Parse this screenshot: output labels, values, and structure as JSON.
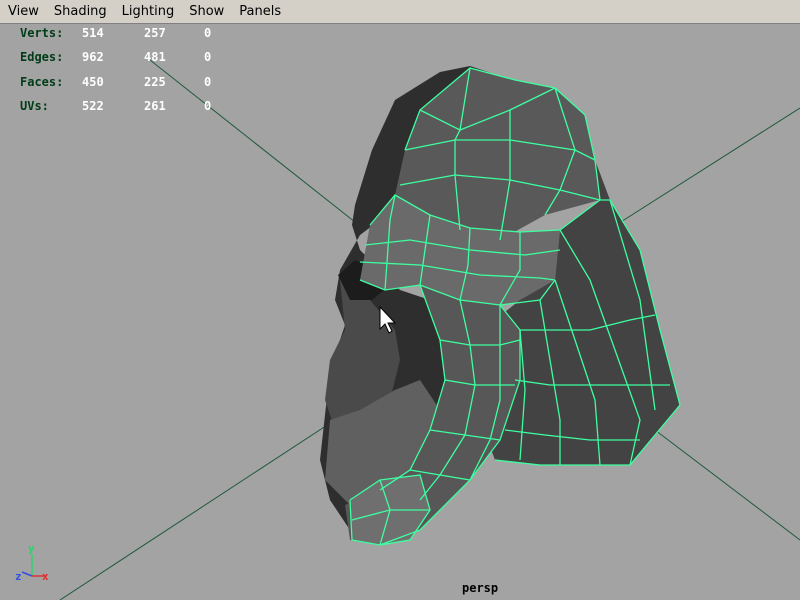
{
  "menubar": {
    "items": [
      "View",
      "Shading",
      "Lighting",
      "Show",
      "Panels"
    ]
  },
  "hud": {
    "rows": [
      {
        "label": "Verts:",
        "v1": "514",
        "v2": "257",
        "v3": "0"
      },
      {
        "label": "Edges:",
        "v1": "962",
        "v2": "481",
        "v3": "0"
      },
      {
        "label": "Faces:",
        "v1": "450",
        "v2": "225",
        "v3": "0"
      },
      {
        "label": "UVs:",
        "v1": "522",
        "v2": "261",
        "v3": "0"
      }
    ]
  },
  "viewport": {
    "camera": "persp",
    "axis": {
      "x": "x",
      "y": "y",
      "z": "z"
    }
  },
  "colors": {
    "background": "#a3a3a3",
    "wireframe": "#3dffa0",
    "mesh_dark": "#3a3a3a",
    "mesh_mid": "#5b5b5b",
    "grid_line": "#1f5a3a",
    "hud_label": "#003c17"
  }
}
